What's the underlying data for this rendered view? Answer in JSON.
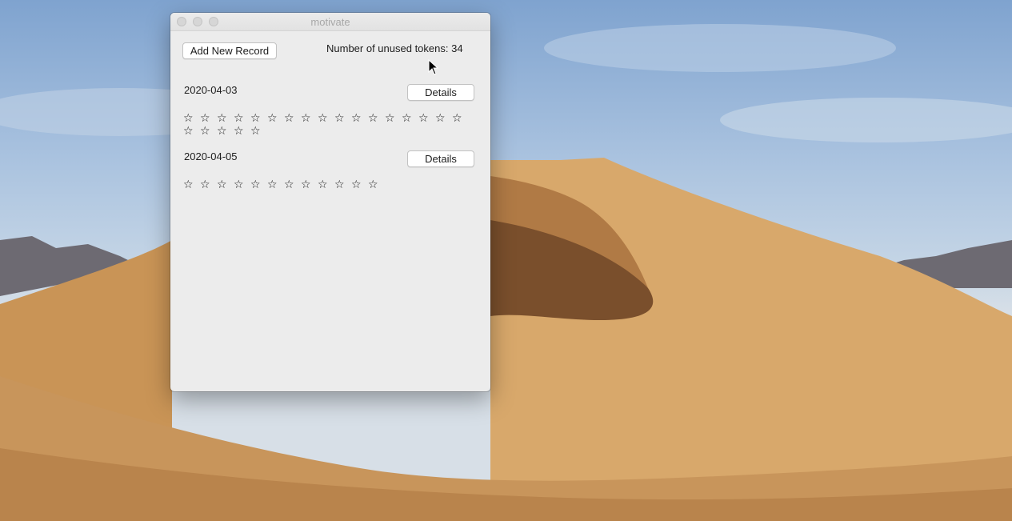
{
  "window": {
    "title": "motivate",
    "add_button_label": "Add New Record",
    "tokens_text": "Number of unused tokens: 34"
  },
  "records": [
    {
      "date": "2020-04-03",
      "details_label": "Details",
      "stars_count": 22,
      "star_glyph": "☆"
    },
    {
      "date": "2020-04-05",
      "details_label": "Details",
      "stars_count": 12,
      "star_glyph": "☆"
    }
  ],
  "icons": {
    "traffic_lights": [
      "close-icon",
      "minimize-icon",
      "zoom-icon"
    ],
    "cursor": "pointer-cursor-icon"
  },
  "colors": {
    "window_bg": "#ececec",
    "sky": "#9bb7d8",
    "dune": "#d9a66a"
  }
}
